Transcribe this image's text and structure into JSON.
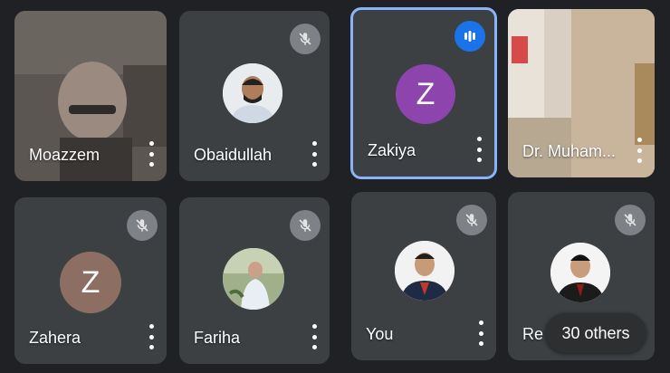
{
  "participants": [
    {
      "name": "Moazzem",
      "feed": "video"
    },
    {
      "name": "Obaidullah",
      "feed": "photo",
      "muted": true
    },
    {
      "name": "Zakiya",
      "feed": "letter",
      "initial": "Z",
      "avatar_color": "#8e44ad",
      "speaking": true
    },
    {
      "name": "Dr. Muham...",
      "feed": "video"
    },
    {
      "name": "Zahera",
      "feed": "letter",
      "initial": "Z",
      "avatar_color": "#8d6e63",
      "muted": true
    },
    {
      "name": "Fariha",
      "feed": "photo",
      "muted": true
    },
    {
      "name": "You",
      "feed": "photo",
      "muted": true
    },
    {
      "name": "Re",
      "feed": "photo",
      "muted": true
    }
  ],
  "others_label": "30 others",
  "colors": {
    "background": "#202124",
    "tile": "#3c4043",
    "active_border": "#8ab4f8",
    "speaking_badge": "#1a73e8"
  },
  "icons": [
    "mic-off-icon",
    "more-vert-icon",
    "audio-level-icon"
  ]
}
